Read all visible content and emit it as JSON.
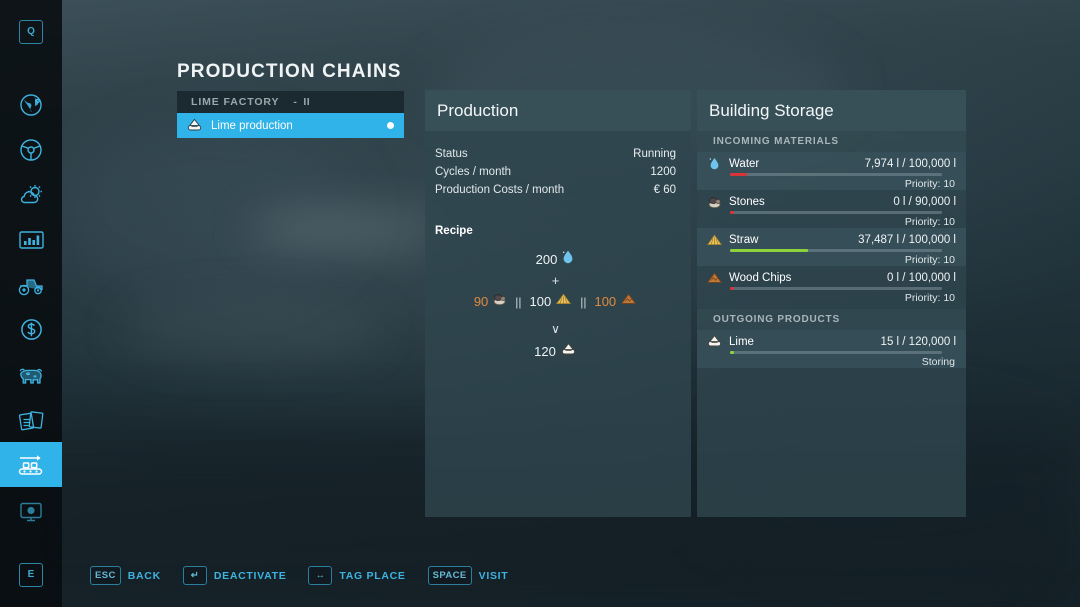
{
  "page": {
    "title": "PRODUCTION CHAINS"
  },
  "colors": {
    "accent": "#2fb3e8",
    "accent_text": "#3eb3e0",
    "orange": "#e08a3c",
    "bar_green": "#8bd23c",
    "bar_red": "#d8343a",
    "panel_bg": "#2f464f"
  },
  "sidebar": {
    "items": [
      {
        "name": "key-q",
        "icon": "letter-q-key-icon",
        "label": "Q",
        "selected": false
      },
      {
        "name": "map",
        "icon": "globe-icon",
        "label": "",
        "selected": false
      },
      {
        "name": "vehicles",
        "icon": "steering-wheel-icon",
        "label": "",
        "selected": false
      },
      {
        "name": "weather",
        "icon": "weather-sun-cloud-icon",
        "label": "",
        "selected": false
      },
      {
        "name": "statistics",
        "icon": "bar-chart-icon",
        "label": "",
        "selected": false
      },
      {
        "name": "machines",
        "icon": "tractor-icon",
        "label": "",
        "selected": false
      },
      {
        "name": "finances",
        "icon": "dollar-coin-icon",
        "label": "",
        "selected": false
      },
      {
        "name": "animals",
        "icon": "cow-icon",
        "label": "",
        "selected": false
      },
      {
        "name": "contracts",
        "icon": "documents-icon",
        "label": "",
        "selected": false
      },
      {
        "name": "production-chains",
        "icon": "conveyor-belt-icon",
        "label": "",
        "selected": true
      },
      {
        "name": "radio",
        "icon": "radio-monitor-icon",
        "label": "",
        "selected": false
      },
      {
        "name": "key-e",
        "icon": "letter-e-key-icon",
        "label": "E",
        "selected": false
      }
    ]
  },
  "factory_list": {
    "group": {
      "name": "LIME FACTORY",
      "level_separator": "-",
      "level": "II"
    },
    "rows": [
      {
        "label": "Lime production",
        "icon": "lime-icon",
        "active": true,
        "status_dot": true
      }
    ]
  },
  "production": {
    "title": "Production",
    "stats": [
      {
        "key": "Status",
        "value": "Running"
      },
      {
        "key": "Cycles / month",
        "value": "1200"
      },
      {
        "key": "Production Costs / month",
        "value": "€ 60"
      }
    ],
    "recipe_title": "Recipe",
    "recipe": {
      "inputs_primary": [
        {
          "amount": "200",
          "icon": "water-drop-icon",
          "color": "white"
        }
      ],
      "plus": "+",
      "inputs_alternatives": [
        {
          "amount": "90",
          "icon": "stones-icon",
          "color": "orange"
        },
        {
          "amount": "100",
          "icon": "straw-icon",
          "color": "white"
        },
        {
          "amount": "100",
          "icon": "wood-chips-icon",
          "color": "orange"
        }
      ],
      "alternative_separator": "||",
      "arrow": "∨",
      "outputs": [
        {
          "amount": "120",
          "icon": "lime-icon",
          "color": "white"
        }
      ]
    }
  },
  "storage": {
    "title": "Building Storage",
    "sections": [
      {
        "label": "INCOMING MATERIALS",
        "rows": [
          {
            "name": "Water",
            "icon": "water-drop-icon",
            "quantity": "7,974 l / 100,000 l",
            "sub": "Priority: 10",
            "fill_percent": 8,
            "fill_color": "#d8343a",
            "shaded": true
          },
          {
            "name": "Stones",
            "icon": "stones-icon",
            "quantity": "0 l / 90,000 l",
            "sub": "Priority: 10",
            "fill_percent": 1,
            "fill_color": "#d8343a",
            "shaded": false
          },
          {
            "name": "Straw",
            "icon": "straw-icon",
            "quantity": "37,487 l / 100,000 l",
            "sub": "Priority: 10",
            "fill_percent": 37,
            "fill_color": "#8bd23c",
            "shaded": true
          },
          {
            "name": "Wood Chips",
            "icon": "wood-chips-icon",
            "quantity": "0 l / 100,000 l",
            "sub": "Priority: 10",
            "fill_percent": 1,
            "fill_color": "#d8343a",
            "shaded": false
          }
        ]
      },
      {
        "label": "OUTGOING PRODUCTS",
        "rows": [
          {
            "name": "Lime",
            "icon": "lime-icon",
            "quantity": "15 l / 120,000 l",
            "sub": "Storing",
            "fill_percent": 1,
            "fill_color": "#8bd23c",
            "shaded": true
          }
        ]
      }
    ]
  },
  "hints": [
    {
      "key": "ESC",
      "label": "BACK",
      "icon": "escape-key-icon"
    },
    {
      "key": "↵",
      "label": "DEACTIVATE",
      "icon": "enter-key-icon"
    },
    {
      "key": "↔",
      "label": "TAG PLACE",
      "icon": "left-right-arrow-key-icon"
    },
    {
      "key": "SPACE",
      "label": "VISIT",
      "icon": "space-key-icon"
    }
  ]
}
